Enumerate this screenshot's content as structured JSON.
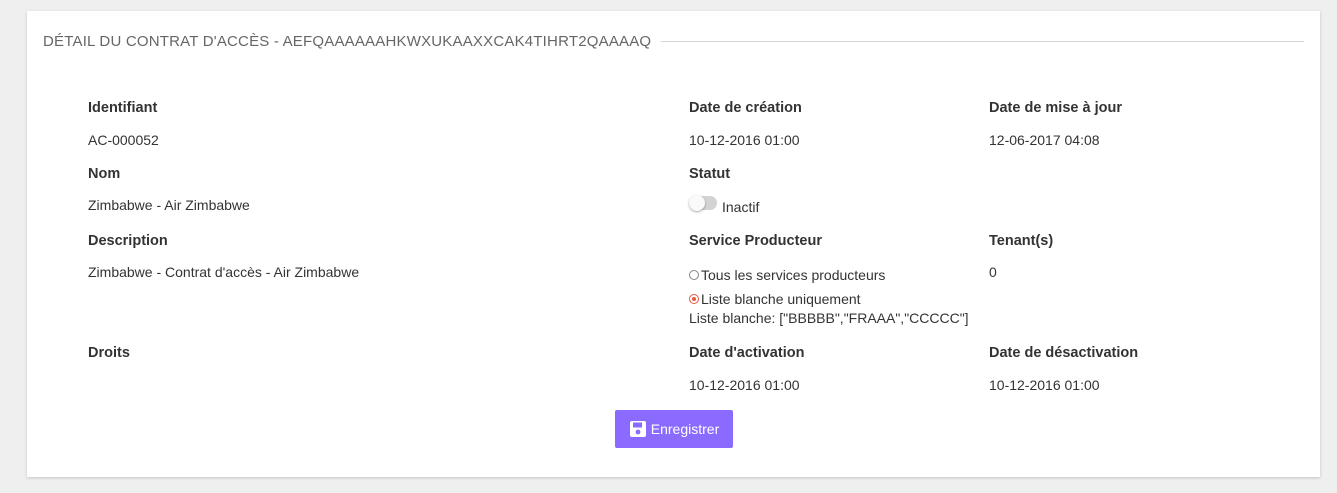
{
  "header": {
    "title": "DÉTAIL DU CONTRAT D'ACCÈS - AEFQAAAAAAHKWXUKAAXXCAK4TIHRT2QAAAAQ"
  },
  "fields": {
    "identifiant": {
      "label": "Identifiant",
      "value": "AC-000052"
    },
    "date_creation": {
      "label": "Date de création",
      "value": "10-12-2016 01:00"
    },
    "date_maj": {
      "label": "Date de mise à jour",
      "value": "12-06-2017 04:08"
    },
    "nom": {
      "label": "Nom",
      "value": "Zimbabwe - Air Zimbabwe"
    },
    "statut": {
      "label": "Statut",
      "value": "Inactif",
      "enabled": false
    },
    "description": {
      "label": "Description",
      "value": "Zimbabwe - Contrat d'accès - Air Zimbabwe"
    },
    "service_producteur": {
      "label": "Service Producteur",
      "options": [
        {
          "label": "Tous les services producteurs",
          "checked": false
        },
        {
          "label": "Liste blanche uniquement",
          "checked": true
        }
      ],
      "whitelist": "Liste blanche: [\"BBBBB\",\"FRAAA\",\"CCCCC\"]"
    },
    "tenants": {
      "label": "Tenant(s)",
      "value": "0"
    },
    "droits": {
      "label": "Droits",
      "value": ""
    },
    "date_activation": {
      "label": "Date d'activation",
      "value": "10-12-2016 01:00"
    },
    "date_desactivation": {
      "label": "Date de désactivation",
      "value": "10-12-2016 01:00"
    }
  },
  "actions": {
    "save_label": "Enregistrer"
  },
  "colors": {
    "accent": "#8b6bff",
    "radio_checked": "#e8583c",
    "background": "#efefef"
  },
  "icons": {
    "save": "floppy-disk-icon"
  }
}
